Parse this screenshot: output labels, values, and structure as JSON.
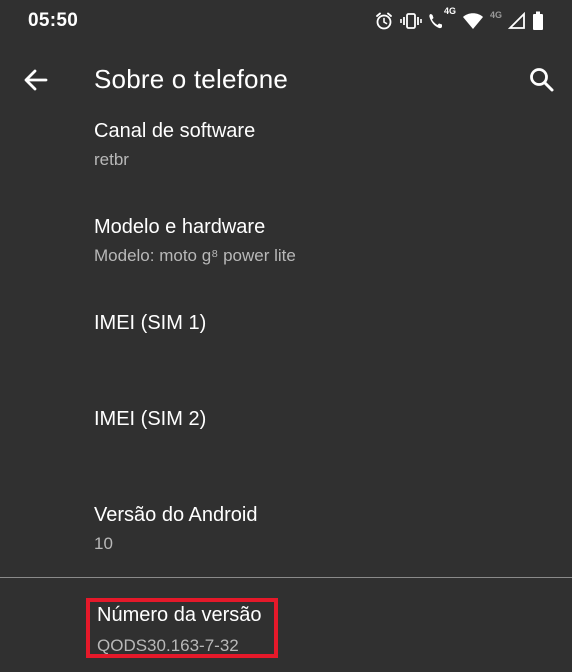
{
  "status_bar": {
    "time": "05:50",
    "network_label_1": "4G",
    "network_label_2": "4G",
    "icons": [
      "alarm-icon",
      "vibrate-icon",
      "wifi-calling-icon",
      "wifi-icon",
      "signal-icon",
      "battery-icon"
    ]
  },
  "app_bar": {
    "title": "Sobre o telefone",
    "back_icon": "arrow-back-icon",
    "search_icon": "search-icon"
  },
  "items": [
    {
      "title": "Canal de software",
      "summary": "retbr"
    },
    {
      "title": "Modelo e hardware",
      "summary": "Modelo: moto g⁸ power lite"
    },
    {
      "title": "IMEI (SIM 1)",
      "summary": ""
    },
    {
      "title": "IMEI (SIM 2)",
      "summary": ""
    },
    {
      "title": "Versão do Android",
      "summary": "10"
    },
    {
      "title": "Número da versão",
      "summary": "QODS30.163-7-32"
    }
  ],
  "colors": {
    "background": "#303030",
    "primary_text": "#ffffff",
    "secondary_text": "#b8b8b8",
    "highlight": "#e5192a"
  }
}
